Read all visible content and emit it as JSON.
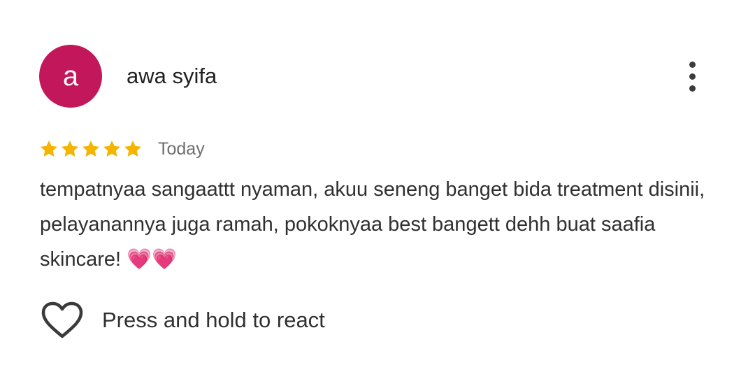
{
  "review": {
    "avatar_letter": "a",
    "avatar_color": "#c2185b",
    "author": "awa syifa",
    "rating": 5,
    "max_rating": 5,
    "star_color": "#f5b400",
    "date": "Today",
    "text": "tempatnyaa sangaattt nyaman, akuu seneng banget bida treatment disinii, pelayanannya juga ramah, pokoknyaa best bangett dehh buat saafia skincare! 💗💗"
  },
  "actions": {
    "more_icon": "more-vertical-icon",
    "react_icon": "heart-outline-icon",
    "react_label": "Press and hold to react"
  }
}
